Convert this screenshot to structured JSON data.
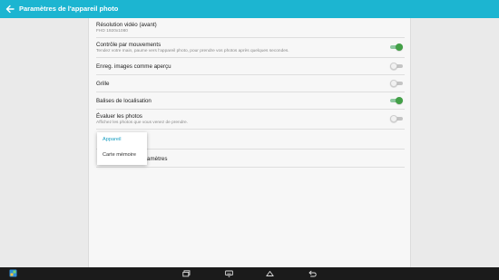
{
  "appbar": {
    "title": "Paramètres de l'appareil photo",
    "back_icon": "arrow-left-icon"
  },
  "settings": [
    {
      "title": "Résolution vidéo (avant)",
      "subtitle": "FHD 1920x1080",
      "toggle": null
    },
    {
      "title": "Contrôle par mouvements",
      "subtitle": "Tendez votre main, paume vers l'appareil photo, pour prendre vos photos après quelques secondes.",
      "toggle": true
    },
    {
      "title": "Enreg. images comme aperçu",
      "subtitle": "",
      "toggle": false
    },
    {
      "title": "Grille",
      "subtitle": "",
      "toggle": false
    },
    {
      "title": "Balises de localisation",
      "subtitle": "",
      "toggle": true
    },
    {
      "title": "Évaluer les photos",
      "subtitle": "Affichez les photos que vous venez de prendre.",
      "toggle": false
    }
  ],
  "obscured_row_text": "ramètres",
  "storage_popup": {
    "options": [
      "Appareil",
      "Carte mémoire"
    ],
    "selected": "Appareil"
  },
  "navbar": {
    "icons": [
      "gallery-icon",
      "recent-apps-icon",
      "keyboard-icon",
      "home-icon",
      "back-icon"
    ]
  },
  "colors": {
    "accent": "#1cb5d1",
    "switch_on": "#43a047",
    "popup_selected": "#1a9fc2",
    "navbar": "#1b1b1b"
  }
}
